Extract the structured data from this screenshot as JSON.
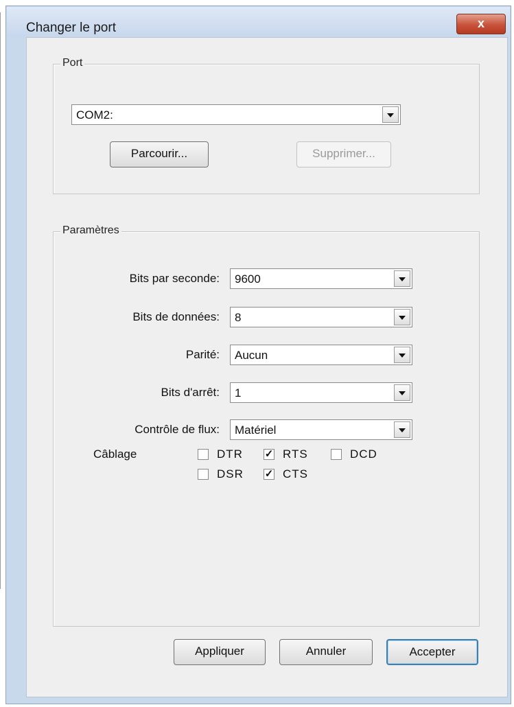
{
  "window": {
    "title": "Changer le port",
    "close_glyph": "x"
  },
  "port_group": {
    "legend": "Port",
    "selected_port": "COM2:",
    "browse_label": "Parcourir...",
    "delete_label": "Supprimer..."
  },
  "params_group": {
    "legend": "Paramètres",
    "fields": [
      {
        "label": "Bits par seconde:",
        "value": "9600"
      },
      {
        "label": "Bits de données:",
        "value": "8"
      },
      {
        "label": "Parité:",
        "value": "Aucun"
      },
      {
        "label": "Bits d'arrêt:",
        "value": "1"
      },
      {
        "label": "Contrôle de flux:",
        "value": "Matériel"
      }
    ],
    "cabling_label": "Câblage",
    "signals": [
      {
        "name": "DTR",
        "checked": false
      },
      {
        "name": "RTS",
        "checked": true
      },
      {
        "name": "DCD",
        "checked": false
      },
      {
        "name": "DSR",
        "checked": false
      },
      {
        "name": "CTS",
        "checked": true
      }
    ]
  },
  "footer": {
    "apply_label": "Appliquer",
    "cancel_label": "Annuler",
    "accept_label": "Accepter"
  }
}
